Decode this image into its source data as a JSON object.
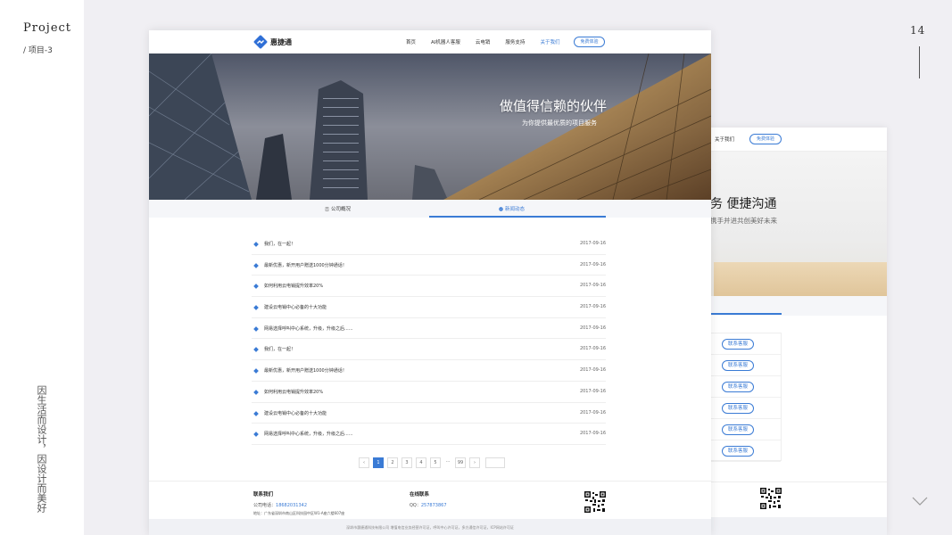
{
  "slide": {
    "title": "Project",
    "subtitle": "/ 项目-3",
    "page_number": "14",
    "vertical_caption": "因生活而设计，因设计而美好"
  },
  "colors": {
    "accent": "#3a7bd5",
    "background": "#f0eff3"
  },
  "main_site": {
    "logo_text": "惠捷通",
    "nav": [
      "首页",
      "AI机器人客服",
      "云电销",
      "服务支持",
      "关于我们"
    ],
    "nav_active": "关于我们",
    "trial_button": "免费体验",
    "hero": {
      "title": "做值得信赖的伙伴",
      "subtitle": "为你提供最优质的项目服务"
    },
    "tabs": [
      "公司概况",
      "新闻动态"
    ],
    "active_tab": "新闻动态",
    "news": [
      {
        "title": "我们，在一起！",
        "date": "2017-09-16"
      },
      {
        "title": "最新优惠，新开用户赠送1000分钟通话！",
        "date": "2017-09-16"
      },
      {
        "title": "如何利用云电销提升效率20%",
        "date": "2017-09-16"
      },
      {
        "title": "建设云电销中心必备的十大功能",
        "date": "2017-09-16"
      },
      {
        "title": "网易选择呼叫中心系统，升级，升级之后......",
        "date": "2017-09-16"
      },
      {
        "title": "我们，在一起！",
        "date": "2017-09-16"
      },
      {
        "title": "最新优惠，新开用户赠送1000分钟通话！",
        "date": "2017-09-16"
      },
      {
        "title": "如何利用云电销提升效率20%",
        "date": "2017-09-16"
      },
      {
        "title": "建设云电销中心必备的十大功能",
        "date": "2017-09-16"
      },
      {
        "title": "网易选择呼叫中心系统，升级，升级之后......",
        "date": "2017-09-16"
      }
    ],
    "pagination": {
      "prev": "‹",
      "pages": [
        "1",
        "2",
        "3",
        "4",
        "5"
      ],
      "current": "1",
      "ellipsis": "···",
      "last": "99",
      "next": "›"
    },
    "footer": {
      "contact_heading": "联系我们",
      "phone_label": "公司电话：",
      "phone": "18682031342",
      "address_label": "地址：",
      "address": "广东省深圳市南山区科技园中区W1-A座六楼607座",
      "online_heading": "在线联系",
      "qq_label": "QQ：",
      "qq": "257873867",
      "copyright": "深圳市惠捷通科技有限公司 增值电信业务经营许可证，呼叫中心许可证，多方通信许可证，ICP网站许可证"
    }
  },
  "back_site": {
    "nav_about": "关于我们",
    "trial_button": "免费体验",
    "hero_title": "务 便捷沟通",
    "hero_subtitle": "携手并进共创美好未来",
    "contact_buttons": [
      "联系客服",
      "联系客服",
      "联系客服",
      "联系客服",
      "联系客服",
      "联系客服"
    ]
  }
}
